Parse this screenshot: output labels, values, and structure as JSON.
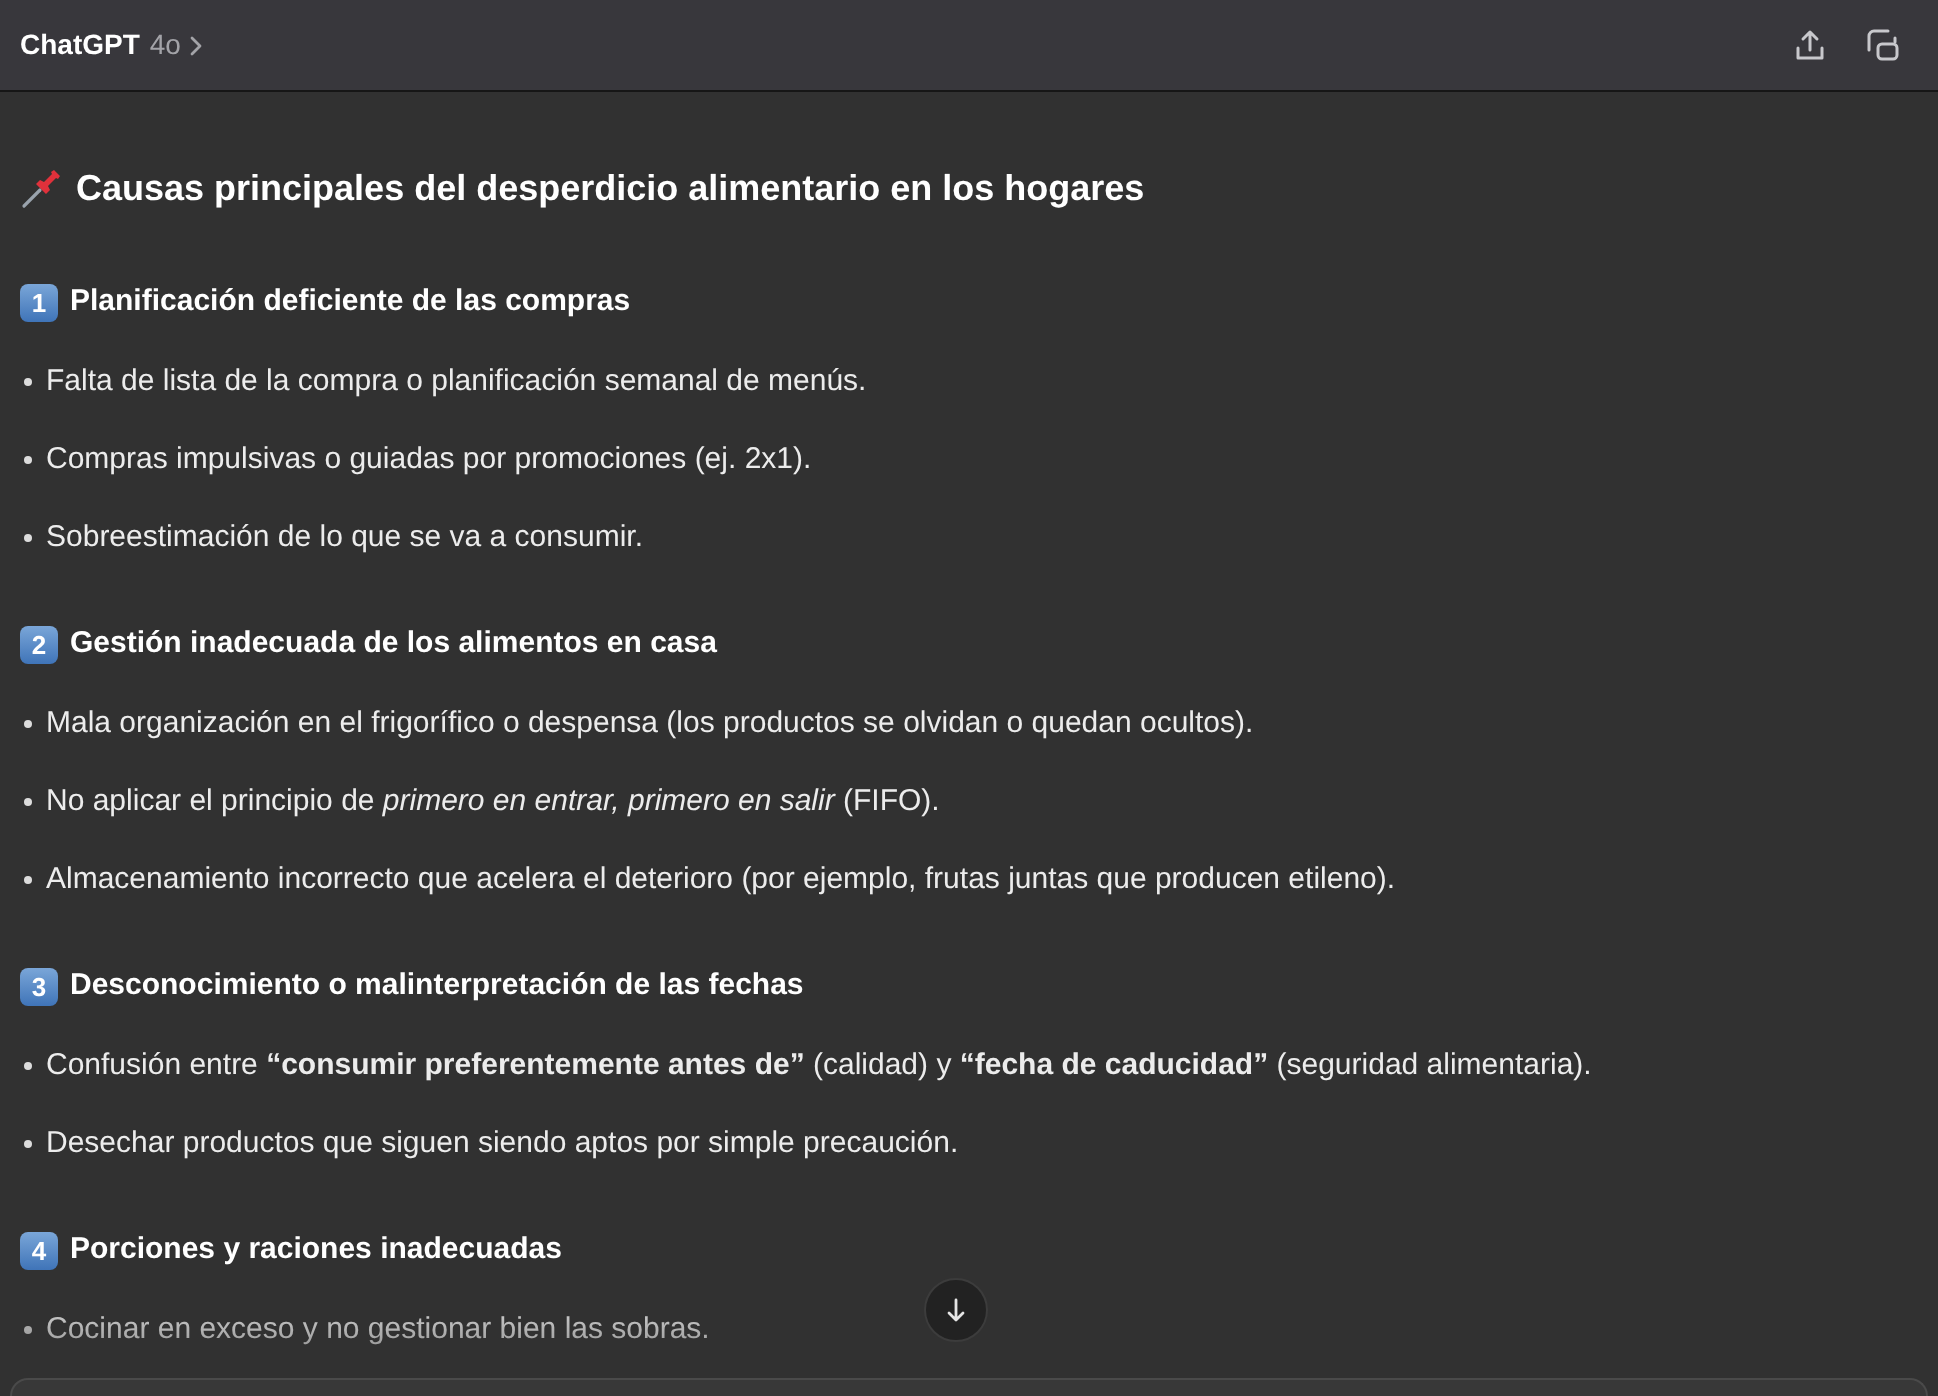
{
  "header": {
    "title": "ChatGPT",
    "model": "4o"
  },
  "message": {
    "heading": "Causas principales del desperdicio alimentario en los hogares",
    "sections": [
      {
        "number": "1",
        "title": "Planificación deficiente de las compras",
        "bullets": [
          "Falta de lista de la compra o planificación semanal de menús.",
          "Compras impulsivas o guiadas por promociones (ej. 2x1).",
          "Sobreestimación de lo que se va a consumir."
        ]
      },
      {
        "number": "2",
        "title": "Gestión inadecuada de los alimentos en casa",
        "bullets": [
          "Mala organización en el frigorífico o despensa (los productos se olvidan o quedan ocultos).",
          "No aplicar el principio de *primero en entrar, primero en salir* (FIFO).",
          "Almacenamiento incorrecto que acelera el deterioro (por ejemplo, frutas juntas que producen etileno)."
        ]
      },
      {
        "number": "3",
        "title": "Desconocimiento o malinterpretación de las fechas",
        "bullets": [
          "Confusión entre **“consumir preferentemente antes de”** (calidad) y **“fecha de caducidad”** (seguridad alimentaria).",
          "Desechar productos que siguen siendo aptos por simple precaución."
        ]
      },
      {
        "number": "4",
        "title": "Porciones y raciones inadecuadas",
        "bullets": [
          "Cocinar en exceso y no gestionar bien las sobras."
        ]
      }
    ]
  }
}
